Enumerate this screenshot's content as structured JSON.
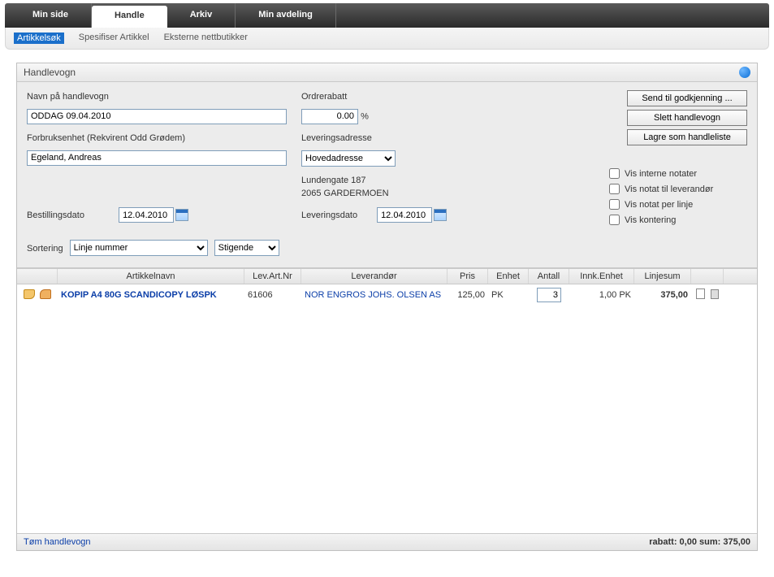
{
  "topTabs": {
    "t0": "Min side",
    "t1": "Handle",
    "t2": "Arkiv",
    "t3": "Min avdeling"
  },
  "subTabs": {
    "s0": "Artikkelsøk",
    "s1": "Spesifiser Artikkel",
    "s2": "Eksterne nettbutikker"
  },
  "panel": {
    "title": "Handlevogn"
  },
  "form": {
    "cartNameLabel": "Navn på handlevogn",
    "cartName": "ODDAG 09.04.2010",
    "discountLabel": "Ordrerabatt",
    "discountValue": "0.00",
    "discountPct": "%",
    "unitLabel": "Forbruksenhet (Rekvirent Odd Grødem)",
    "unitValue": "Egeland, Andreas",
    "deliveryAddrLabel": "Leveringsadresse",
    "deliverySelect": "Hovedadresse",
    "addrLine1": "Lundengate 187",
    "addrLine2": "2065 GARDERMOEN",
    "orderDateLabel": "Bestillingsdato",
    "orderDate": "12.04.2010",
    "deliveryDateLabel": "Leveringsdato",
    "deliveryDate": "12.04.2010",
    "sortLabel": "Sortering",
    "sortField": "Linje nummer",
    "sortDir": "Stigende"
  },
  "actions": {
    "approve": "Send til godkjenning ...",
    "delete": "Slett handlevogn",
    "saveList": "Lagre som handleliste"
  },
  "checks": {
    "c0": "Vis interne notater",
    "c1": "Vis notat til leverandør",
    "c2": "Vis notat per linje",
    "c3": "Vis kontering"
  },
  "grid": {
    "h_name": "Artikkelnavn",
    "h_art": "Lev.Art.Nr",
    "h_vendor": "Leverandør",
    "h_price": "Pris",
    "h_unit": "Enhet",
    "h_qty": "Antall",
    "h_iunit": "Innk.Enhet",
    "h_sum": "Linjesum"
  },
  "rows": [
    {
      "name": "KOPIP A4 80G SCANDICOPY LØSPK",
      "art": "61606",
      "vendor": "NOR ENGROS JOHS. OLSEN AS",
      "price": "125,00",
      "unit": "PK",
      "qty": "3",
      "iunit": "1,00 PK",
      "sum": "375,00"
    }
  ],
  "footer": {
    "empty": "Tøm handlevogn",
    "summary": "rabatt: 0,00 sum: 375,00"
  }
}
